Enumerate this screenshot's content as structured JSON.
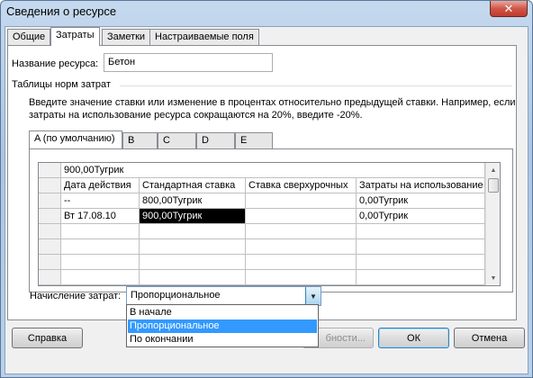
{
  "window": {
    "title": "Сведения о ресурсе",
    "close_glyph": "✕"
  },
  "tabs": [
    {
      "label": "Общие",
      "active": false
    },
    {
      "label": "Затраты",
      "active": true
    },
    {
      "label": "Заметки",
      "active": false
    },
    {
      "label": "Настраиваемые поля",
      "active": false
    }
  ],
  "resource": {
    "name_label": "Название ресурса:",
    "name_value": "Бетон"
  },
  "cost_tables": {
    "group_label": "Таблицы норм затрат",
    "instructions_line1": "Введите значение ставки или изменение в процентах относительно предыдущей ставки. Например, если",
    "instructions_line2": "затраты на использование ресурса сокращаются на 20%, введите -20%.",
    "tabs": [
      {
        "label": "A (по умолчанию)",
        "active": true
      },
      {
        "label": "B",
        "active": false
      },
      {
        "label": "C",
        "active": false
      },
      {
        "label": "D",
        "active": false
      },
      {
        "label": "E",
        "active": false
      }
    ],
    "edit_value": "900,00Тугрик",
    "columns": [
      "Дата действия",
      "Стандартная ставка",
      "Ставка сверхурочных",
      "Затраты на использование"
    ],
    "rows": [
      [
        "--",
        "800,00Тугрик",
        "",
        "0,00Тугрик"
      ],
      [
        "Вт 17.08.10",
        "900,00Тугрик",
        "",
        "0,00Тугрик"
      ],
      [
        "",
        "",
        "",
        ""
      ],
      [
        "",
        "",
        "",
        ""
      ],
      [
        "",
        "",
        "",
        ""
      ],
      [
        "",
        "",
        "",
        ""
      ]
    ]
  },
  "accrual": {
    "label": "Начисление затрат:",
    "selected": "Пропорциональное",
    "options": [
      "В начале",
      "Пропорциональное",
      "По окончании"
    ],
    "highlighted_option": "Пропорциональное"
  },
  "buttons": {
    "help": "Справка",
    "details_partial": "бности...",
    "ok": "ОК",
    "cancel": "Отмена"
  }
}
